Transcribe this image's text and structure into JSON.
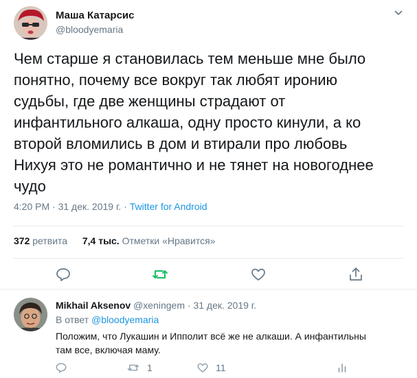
{
  "tweet": {
    "author_name": "Маша Катарсис",
    "author_handle": "@bloodyemaria",
    "text_lines": [
      "Чем старше я становилась тем меньше мне было",
      "понятно, почему все вокруг так любят иронию",
      "судьбы, где две женщины страдают от",
      "инфантильного алкаша, одну просто кинули, а ко",
      "второй вломились в дом и втирали про любовь",
      "Нихуя это не романтично и не тянет на новогоднее",
      "чудо"
    ],
    "time": "4:20 PM",
    "dot1": " · ",
    "date": "31 дек. 2019 г.",
    "dot2": " · ",
    "source": "Twitter for Android",
    "retweets_count": "372",
    "retweets_label": "ретвита",
    "likes_count": "7,4 тыс.",
    "likes_label": "Отметки «Нравится»",
    "icons": [
      "chevron-down-icon",
      "reply-icon",
      "retweet-icon",
      "like-icon",
      "share-icon"
    ],
    "retweet_color": "#17bf63"
  },
  "reply": {
    "author_name": "Mikhail Aksenov",
    "author_handle": "@xeningem",
    "dot": " · ",
    "date": "31 дек. 2019 г.",
    "reply_to_label": "В ответ",
    "reply_to_handle": "@bloodyemaria",
    "text_lines": [
      "Положим, что Лукашин и Ипполит всё же не алкаши. А инфантильны",
      "там все, включая маму."
    ],
    "retweets": "1",
    "likes": "11",
    "icons": [
      "reply-icon",
      "retweet-icon",
      "like-icon",
      "analytics-icon"
    ]
  },
  "colors": {
    "text": "#14171a",
    "muted": "#657786",
    "link": "#1b95e0",
    "border": "#e6ecf0"
  }
}
